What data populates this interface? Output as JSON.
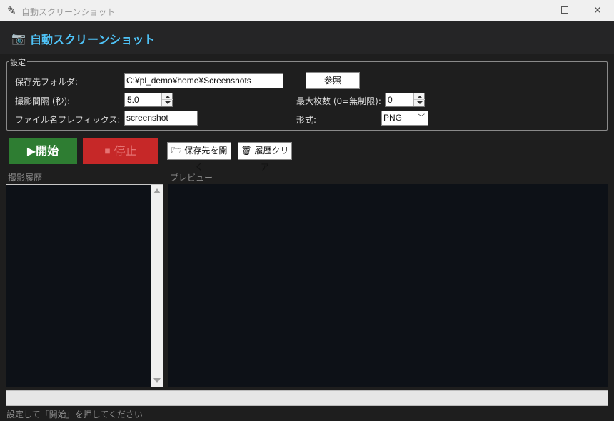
{
  "window": {
    "title": "自動スクリーンショット",
    "minimize_icon": "minimize-icon",
    "maximize_icon": "maximize-icon",
    "close_icon": "close-icon",
    "close_glyph": "✕"
  },
  "header": {
    "icon": "camera-icon",
    "icon_glyph": "📷",
    "title": "自動スクリーンショット",
    "accent_color": "#4fc3f7"
  },
  "settings": {
    "legend": "設定",
    "save_folder_label": "保存先フォルダ:",
    "save_folder_value": "C:¥pl_demo¥home¥Screenshots",
    "browse_label": "参照",
    "interval_label": "撮影間隔 (秒):",
    "interval_value": "5.0",
    "max_count_label": "最大枚数 (0=無制限):",
    "max_count_value": "0",
    "prefix_label": "ファイル名プレフィックス:",
    "prefix_value": "screenshot",
    "format_label": "形式:",
    "format_value": "PNG"
  },
  "actions": {
    "start_label": "▶開始",
    "start_color": "#2e7d32",
    "stop_label": "⏹ 停止",
    "stop_color": "#c62828",
    "open_folder_label": "🗁 保存先を開く",
    "clear_history_label": "🗑 履歴クリア"
  },
  "panels": {
    "history_title": "撮影履歴",
    "preview_title": "プレビュー"
  },
  "progress": {
    "value": 0
  },
  "status": {
    "text": "設定して「開始」を押してください"
  }
}
